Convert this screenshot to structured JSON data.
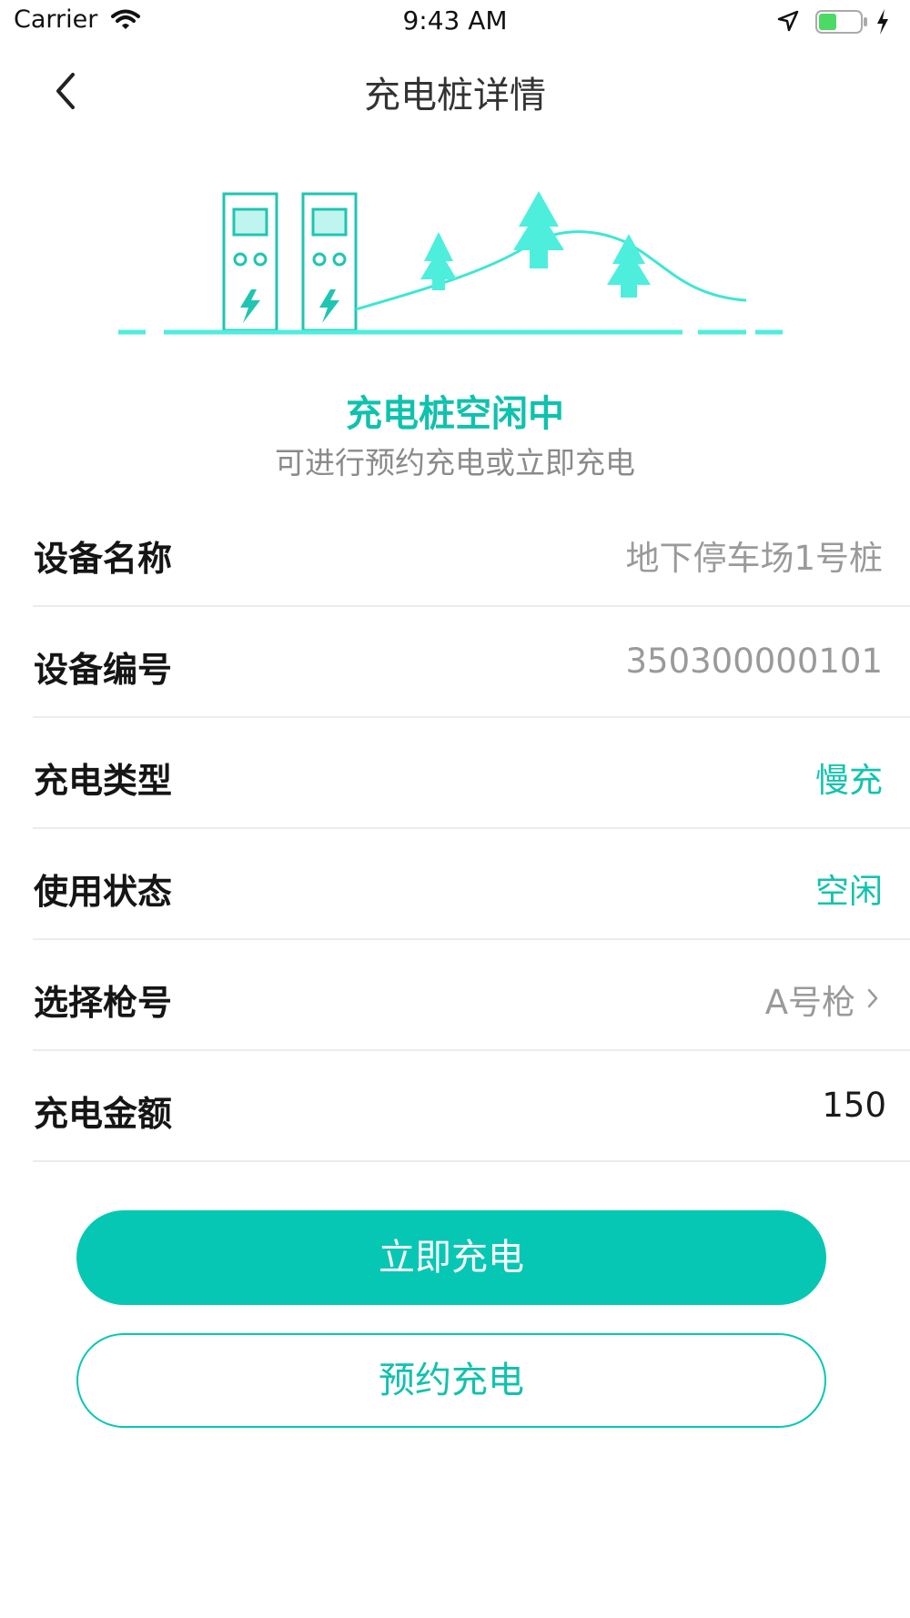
{
  "status_bar": {
    "carrier": "Carrier",
    "time": "9:43 AM"
  },
  "nav": {
    "title": "充电桩详情"
  },
  "status": {
    "title": "充电桩空闲中",
    "subtitle": "可进行预约充电或立即充电"
  },
  "details": [
    {
      "label": "设备名称",
      "value": "地下停车场1号桩"
    },
    {
      "label": "设备编号",
      "value": "350300000101"
    },
    {
      "label": "充电类型",
      "value": "慢充"
    },
    {
      "label": "使用状态",
      "value": "空闲"
    },
    {
      "label": "选择枪号",
      "value": "A号枪"
    },
    {
      "label": "充电金额",
      "value": "150"
    }
  ],
  "actions": {
    "charge_now": "立即充电",
    "reserve": "预约充电"
  },
  "colors": {
    "accent": "#06c7b4",
    "illustration": "#4eeedd",
    "battery": "#4cd964"
  },
  "icons": [
    "wifi-icon",
    "location-arrow-icon",
    "battery-icon",
    "charging-bolt-icon",
    "back-chevron-icon",
    "chevron-right-icon"
  ]
}
